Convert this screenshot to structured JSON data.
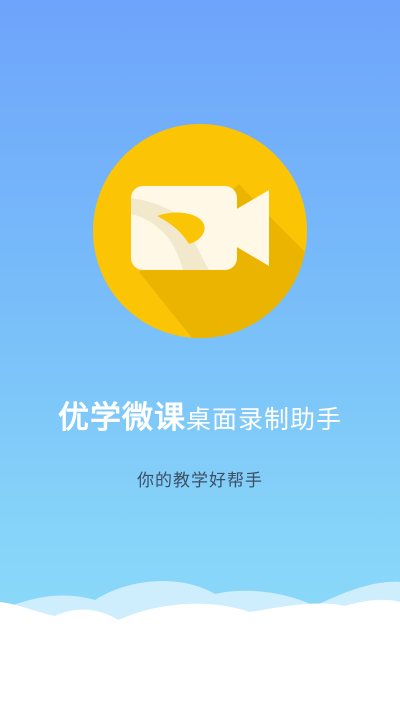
{
  "app": {
    "name": "优学微课",
    "subtitle": "桌面录制助手",
    "slogan": "你的教学好帮手"
  },
  "logo": {
    "icon": "video-camera-icon",
    "circle_color": "#fbc506",
    "shadow_color": "#eab400",
    "camera_color": "#fff8e6"
  },
  "colors": {
    "background_top": "#6ea4fb",
    "background_bottom": "#8fdcf9",
    "cloud": "#ffffff"
  }
}
